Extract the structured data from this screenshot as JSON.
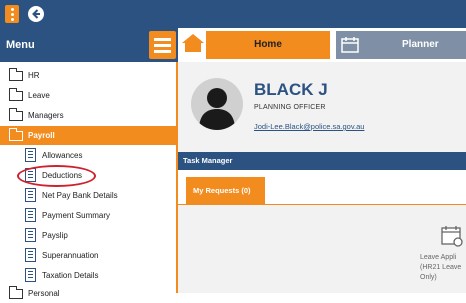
{
  "app": {
    "menu_title": "Menu"
  },
  "sidebar": {
    "items": [
      {
        "label": "HR",
        "icon": "folder-icon"
      },
      {
        "label": "Leave",
        "icon": "folder-icon"
      },
      {
        "label": "Managers",
        "icon": "folder-icon"
      },
      {
        "label": "Payroll",
        "icon": "folder-open-icon",
        "active": true
      },
      {
        "label": "Allowances",
        "icon": "document-icon"
      },
      {
        "label": "Deductions",
        "icon": "document-icon",
        "circled": true
      },
      {
        "label": "Net Pay Bank Details",
        "icon": "document-icon"
      },
      {
        "label": "Payment Summary",
        "icon": "document-icon"
      },
      {
        "label": "Payslip",
        "icon": "document-icon"
      },
      {
        "label": "Superannuation",
        "icon": "document-icon"
      },
      {
        "label": "Taxation Details",
        "icon": "document-icon"
      },
      {
        "label": "Personal",
        "icon": "folder-icon"
      }
    ]
  },
  "tabs": [
    {
      "label": "Home",
      "icon": "home-icon",
      "active": true
    },
    {
      "label": "Planner",
      "icon": "calendar-icon",
      "active": false
    }
  ],
  "profile": {
    "name": "BLACK J",
    "role": "PLANNING OFFICER",
    "email": "Jodi-Lee.Black@police.sa.gov.au"
  },
  "task_manager": {
    "title": "Task Manager",
    "tab_label": "My Requests (0)",
    "tile_label_1": "Leave Appli",
    "tile_label_2": "(HR21 Leave",
    "tile_label_3": "Only)"
  },
  "colors": {
    "navy": "#2c5282",
    "orange": "#f28c1e",
    "highlight_red": "#d0202e"
  }
}
